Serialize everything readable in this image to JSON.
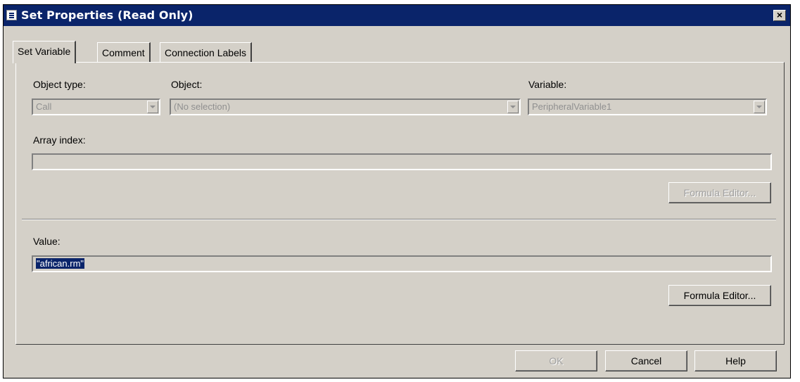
{
  "window": {
    "title": "Set Properties (Read Only)",
    "close_label": "×"
  },
  "tabs": [
    {
      "label": "Set Variable",
      "active": true
    },
    {
      "label": "Comment",
      "active": false
    },
    {
      "label": "Connection Labels",
      "active": false
    }
  ],
  "fields": {
    "object_type": {
      "label": "Object type:",
      "value": "Call"
    },
    "object": {
      "label": "Object:",
      "value": "(No selection)"
    },
    "variable": {
      "label": "Variable:",
      "value": "PeripheralVariable1"
    },
    "array_index": {
      "label": "Array index:",
      "value": ""
    },
    "value": {
      "label": "Value:",
      "value": "\"african.rm\""
    }
  },
  "buttons": {
    "formula_editor_disabled": "Formula Editor...",
    "formula_editor": "Formula Editor...",
    "ok": "OK",
    "cancel": "Cancel",
    "help": "Help"
  }
}
